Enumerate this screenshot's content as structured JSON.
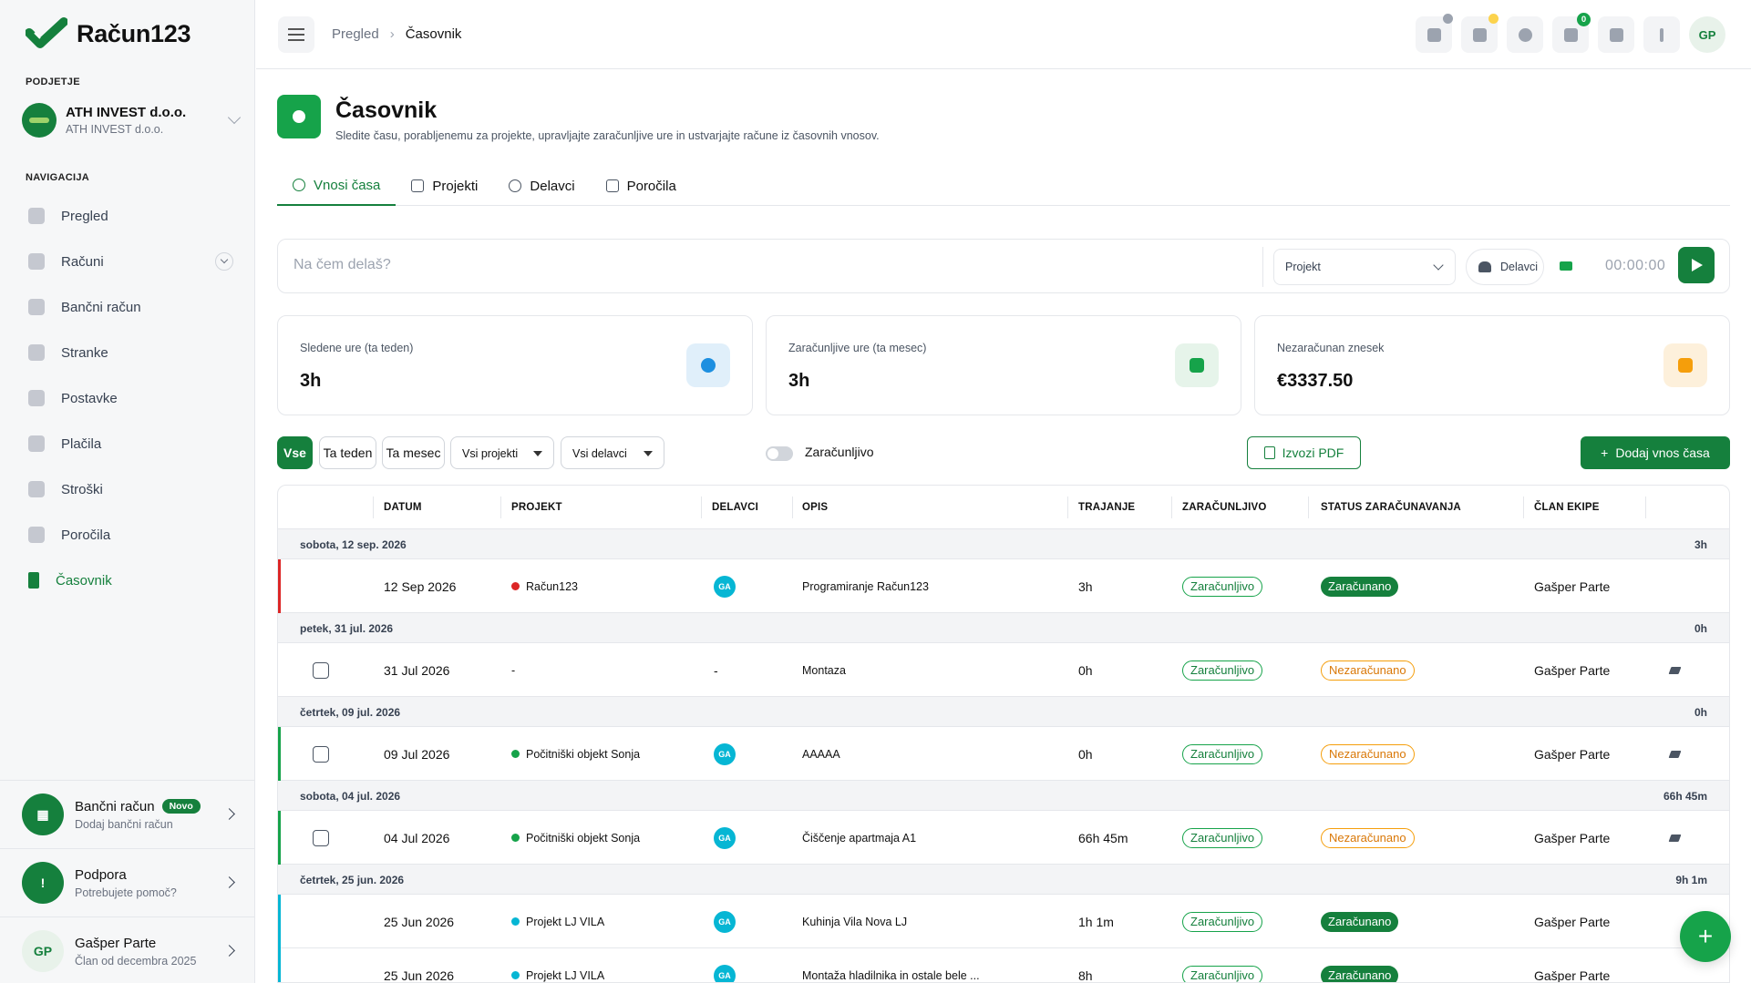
{
  "app": {
    "logo_text": "Račun123",
    "company_section_label": "PODJETJE",
    "company_name": "ATH INVEST d.o.o.",
    "company_sub": "ATH INVEST d.o.o.",
    "nav_section_label": "NAVIGACIJA"
  },
  "sidebar": {
    "items": [
      {
        "label": "Pregled",
        "icon": "chart-icon"
      },
      {
        "label": "Računi",
        "icon": "invoice-icon"
      },
      {
        "label": "Bančni račun",
        "icon": "bank-icon"
      },
      {
        "label": "Stranke",
        "icon": "users-icon"
      },
      {
        "label": "Postavke",
        "icon": "box-icon"
      },
      {
        "label": "Plačila",
        "icon": "coin-icon"
      },
      {
        "label": "Stroški",
        "icon": "receipt-icon"
      },
      {
        "label": "Poročila",
        "icon": "report-icon"
      },
      {
        "label": "Časovnik",
        "icon": "hourglass-icon"
      }
    ],
    "bank_card": {
      "title": "Bančni račun",
      "badge": "Novo",
      "sub": "Dodaj bančni račun"
    },
    "support_card": {
      "title": "Podpora",
      "sub": "Potrebujete pomoč?"
    },
    "user_card": {
      "initials": "GP",
      "name": "Gašper Parte",
      "sub": "Član od decembra 2025"
    }
  },
  "topbar": {
    "breadcrumb_parent": "Pregled",
    "breadcrumb_current": "Časovnik",
    "notification_count": "0",
    "avatar_initials": "GP"
  },
  "page": {
    "title": "Časovnik",
    "subtitle": "Sledite času, porabljenemu za projekte, upravljajte zaračunljive ure in ustvarjajte račune iz časovnih vnosov.",
    "tabs": [
      "Vnosi časa",
      "Projekti",
      "Delavci",
      "Poročila"
    ]
  },
  "tracker": {
    "placeholder": "Na čem delaš?",
    "project_placeholder": "Projekt",
    "workers_label": "Delavci",
    "time": "00:00:00"
  },
  "stats": [
    {
      "label": "Sledene ure (ta teden)",
      "value": "3h",
      "bg": "#e0effa",
      "fg": "#1d8fe0"
    },
    {
      "label": "Zaračunljive ure (ta mesec)",
      "value": "3h",
      "bg": "#e6f4ea",
      "fg": "#16a34a"
    },
    {
      "label": "Nezaračunan znesek",
      "value": "€3337.50",
      "bg": "#fdf0db",
      "fg": "#f59e0b"
    }
  ],
  "filters": {
    "all": "Vse",
    "this_week": "Ta teden",
    "this_month": "Ta mesec",
    "projects": "Vsi projekti",
    "workers": "Vsi delavci",
    "billable_toggle": "Zaračunljivo",
    "export_pdf": "Izvozi PDF",
    "add_entry": "Dodaj vnos časa"
  },
  "table": {
    "headers": [
      "DATUM",
      "PROJEKT",
      "DELAVCI",
      "OPIS",
      "TRAJANJE",
      "ZARAČUNLJIVO",
      "STATUS ZARAČUNAVANJA",
      "ČLAN EKIPE"
    ],
    "groups": [
      {
        "label": "sobota, 12 sep. 2026",
        "total": "3h",
        "rows": [
          {
            "edge": "#dc2626",
            "check": false,
            "date": "12 Sep 2026",
            "project": "Račun123",
            "dot": "#dc2626",
            "worker": "GA",
            "desc": "Programiranje Račun123",
            "duration": "3h",
            "billable": "Zaračunljivo",
            "status": "Zaračunano",
            "status_type": "billed",
            "member": "Gašper Parte",
            "edit": false
          }
        ]
      },
      {
        "label": "petek, 31 jul. 2026",
        "total": "0h",
        "rows": [
          {
            "edge": "",
            "check": true,
            "date": "31 Jul 2026",
            "project": "-",
            "dot": "",
            "worker": "-",
            "desc": "Montaza",
            "duration": "0h",
            "billable": "Zaračunljivo",
            "status": "Nezaračunano",
            "status_type": "unbilled",
            "member": "Gašper Parte",
            "edit": true
          }
        ]
      },
      {
        "label": "četrtek, 09 jul. 2026",
        "total": "0h",
        "rows": [
          {
            "edge": "#16a34a",
            "check": true,
            "date": "09 Jul 2026",
            "project": "Počitniški objekt Sonja",
            "dot": "#16a34a",
            "worker": "GA",
            "desc": "AAAAA",
            "duration": "0h",
            "billable": "Zaračunljivo",
            "status": "Nezaračunano",
            "status_type": "unbilled",
            "member": "Gašper Parte",
            "edit": true
          }
        ]
      },
      {
        "label": "sobota, 04 jul. 2026",
        "total": "66h 45m",
        "rows": [
          {
            "edge": "#16a34a",
            "check": true,
            "date": "04 Jul 2026",
            "project": "Počitniški objekt Sonja",
            "dot": "#16a34a",
            "worker": "GA",
            "desc": "Čiščenje apartmaja A1",
            "duration": "66h 45m",
            "billable": "Zaračunljivo",
            "status": "Nezaračunano",
            "status_type": "unbilled",
            "member": "Gašper Parte",
            "edit": true
          }
        ]
      },
      {
        "label": "četrtek, 25 jun. 2026",
        "total": "9h 1m",
        "rows": [
          {
            "edge": "#06b6d4",
            "check": false,
            "date": "25 Jun 2026",
            "project": "Projekt LJ VILA",
            "dot": "#06b6d4",
            "worker": "GA",
            "desc": "Kuhinja Vila Nova LJ",
            "duration": "1h 1m",
            "billable": "Zaračunljivo",
            "status": "Zaračunano",
            "status_type": "billed",
            "member": "Gašper Parte",
            "edit": false
          },
          {
            "edge": "#06b6d4",
            "check": false,
            "date": "25 Jun 2026",
            "project": "Projekt LJ VILA",
            "dot": "#06b6d4",
            "worker": "GA",
            "desc": "Montaža hladilnika in ostale bele ...",
            "duration": "8h",
            "billable": "Zaračunljivo",
            "status": "Zaračunano",
            "status_type": "billed",
            "member": "Gašper Parte",
            "edit": false
          }
        ]
      }
    ]
  },
  "fab_label": "+"
}
